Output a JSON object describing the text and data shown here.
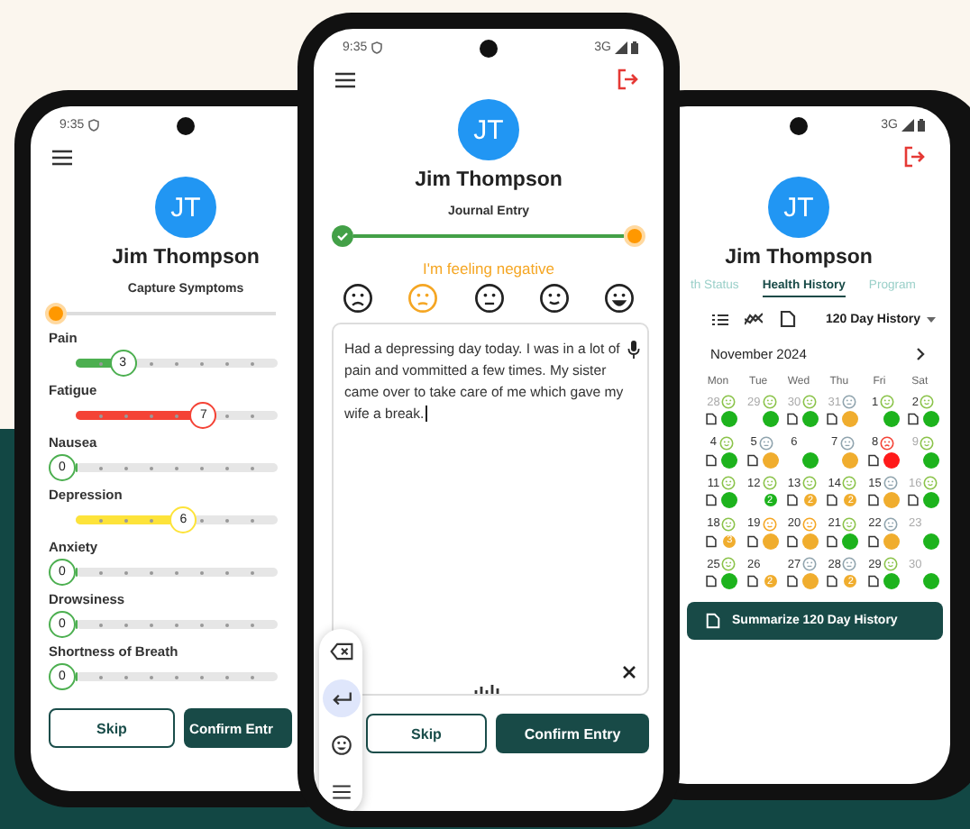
{
  "left_phone": {
    "status_time": "9:35",
    "user": {
      "initials": "JT",
      "name": "Jim Thompson"
    },
    "title": "Capture Symptoms",
    "step_progress": {
      "level": 0
    },
    "symptoms": [
      {
        "name": "Pain",
        "reading": "3",
        "level": 0.3,
        "color": "#4caf50"
      },
      {
        "name": "Fatigue",
        "reading": "7",
        "level": 0.7,
        "color": "#f44336"
      },
      {
        "name": "Nausea",
        "reading": "0",
        "level": 0,
        "color": "#4caf50"
      },
      {
        "name": "Depression",
        "reading": "6",
        "level": 0.6,
        "color": "#fde33a"
      },
      {
        "name": "Anxiety",
        "reading": "0",
        "level": 0,
        "color": "#4caf50"
      },
      {
        "name": "Drowsiness",
        "reading": "0",
        "level": 0,
        "color": "#4caf50"
      },
      {
        "name": "Shortness of Breath",
        "reading": "0",
        "level": 0,
        "color": "#4caf50"
      }
    ],
    "buttons": [
      "Skip",
      "Confirm Entr"
    ]
  },
  "center_phone": {
    "status_time": "9:35",
    "network": "3G",
    "user": {
      "initials": "JT",
      "name": "Jim Thompson"
    },
    "title": "Journal Entry",
    "step_progress": {
      "level": 1
    },
    "feeling": "I'm feeling negative",
    "moods": [
      {
        "kind": "sad",
        "selected": false
      },
      {
        "kind": "slightly-sad",
        "selected": true
      },
      {
        "kind": "neutral",
        "selected": false
      },
      {
        "kind": "slightly-happy",
        "selected": false
      },
      {
        "kind": "happy",
        "selected": false
      }
    ],
    "journal_text": "Had a depressing day today. I was in a lot of pain and vommitted a few times. My sister came over to take care of me which gave my wife a break.",
    "keyboard_toolbar": [
      {
        "kind": "backspace",
        "selected": false
      },
      {
        "kind": "enter",
        "selected": true
      },
      {
        "kind": "emoji",
        "selected": false
      },
      {
        "kind": "menu",
        "selected": false
      }
    ],
    "buttons": [
      "Skip",
      "Confirm Entry"
    ]
  },
  "right_phone": {
    "network": "3G",
    "user": {
      "initials": "JT",
      "name": "Jim Thompson"
    },
    "tabs": [
      {
        "label": "th Status",
        "selected": false
      },
      {
        "label": "Health History",
        "selected": true
      },
      {
        "label": "Program",
        "selected": false
      }
    ],
    "range_dropdown": "120 Day History",
    "month": "November 2024",
    "weekdays": [
      "Mon",
      "Tue",
      "Wed",
      "Thu",
      "Fri",
      "Sat"
    ],
    "weeks": [
      {
        "days": [
          {
            "day": "28",
            "muted": true,
            "kind": "good",
            "note": true,
            "color": "#1db31d"
          },
          {
            "day": "29",
            "muted": true,
            "kind": "good",
            "note": false,
            "color": "#1db31d"
          },
          {
            "day": "30",
            "muted": true,
            "kind": "good",
            "note": true,
            "color": "#1db31d"
          },
          {
            "day": "31",
            "muted": true,
            "kind": "neutral",
            "note": true,
            "color": "#f0ad2e"
          },
          {
            "day": "1",
            "muted": false,
            "kind": "good",
            "note": false,
            "color": "#1db31d"
          },
          {
            "day": "2",
            "muted": false,
            "kind": "good",
            "note": true,
            "color": "#1db31d"
          }
        ]
      },
      {
        "days": [
          {
            "day": "4",
            "muted": false,
            "kind": "good",
            "note": true,
            "color": "#1db31d"
          },
          {
            "day": "5",
            "muted": false,
            "kind": "neutral",
            "note": true,
            "color": "#f0ad2e"
          },
          {
            "day": "6",
            "muted": false,
            "kind": "no-mood",
            "note": false,
            "color": "#1db31d"
          },
          {
            "day": "7",
            "muted": false,
            "kind": "neutral",
            "note": false,
            "color": "#f0ad2e"
          },
          {
            "day": "8",
            "muted": false,
            "kind": "bad",
            "note": true,
            "color": "#ff1a1a"
          },
          {
            "day": "9",
            "muted": true,
            "kind": "good",
            "note": false,
            "color": "#1db31d"
          }
        ]
      },
      {
        "days": [
          {
            "day": "11",
            "muted": false,
            "kind": "good",
            "note": true,
            "color": "#1db31d"
          },
          {
            "day": "12",
            "muted": false,
            "kind": "good",
            "note": false,
            "color": "#1db31d",
            "count": "2"
          },
          {
            "day": "13",
            "muted": false,
            "kind": "good",
            "note": true,
            "color": "#f0ad2e",
            "count": "2"
          },
          {
            "day": "14",
            "muted": false,
            "kind": "good",
            "note": true,
            "color": "#f0ad2e",
            "count": "2"
          },
          {
            "day": "15",
            "muted": false,
            "kind": "neutral",
            "note": true,
            "color": "#f0ad2e"
          },
          {
            "day": "16",
            "muted": true,
            "kind": "good",
            "note": true,
            "color": "#1db31d"
          }
        ]
      },
      {
        "days": [
          {
            "day": "18",
            "muted": false,
            "kind": "good",
            "note": true,
            "color": "#f0ad2e",
            "count": "3"
          },
          {
            "day": "19",
            "muted": false,
            "kind": "low",
            "note": true,
            "color": "#f0ad2e"
          },
          {
            "day": "20",
            "muted": false,
            "kind": "low",
            "note": true,
            "color": "#f0ad2e"
          },
          {
            "day": "21",
            "muted": false,
            "kind": "good",
            "note": true,
            "color": "#1db31d"
          },
          {
            "day": "22",
            "muted": false,
            "kind": "neutral",
            "note": true,
            "color": "#f0ad2e"
          },
          {
            "day": "23",
            "muted": true,
            "kind": "no-mood",
            "note": false,
            "color": "#1db31d"
          }
        ]
      },
      {
        "days": [
          {
            "day": "25",
            "muted": false,
            "kind": "good",
            "note": true,
            "color": "#1db31d"
          },
          {
            "day": "26",
            "muted": false,
            "kind": "no-mood",
            "note": true,
            "color": "#f0ad2e",
            "count": "2"
          },
          {
            "day": "27",
            "muted": false,
            "kind": "neutral",
            "note": true,
            "color": "#f0ad2e"
          },
          {
            "day": "28",
            "muted": false,
            "kind": "neutral",
            "note": true,
            "color": "#f0ad2e",
            "count": "2"
          },
          {
            "day": "29",
            "muted": false,
            "kind": "good",
            "note": true,
            "color": "#1db31d"
          },
          {
            "day": "30",
            "muted": true,
            "kind": "no-mood",
            "note": false,
            "color": "#1db31d"
          }
        ]
      }
    ],
    "summarize_button": "Summarize 120 Day History"
  }
}
